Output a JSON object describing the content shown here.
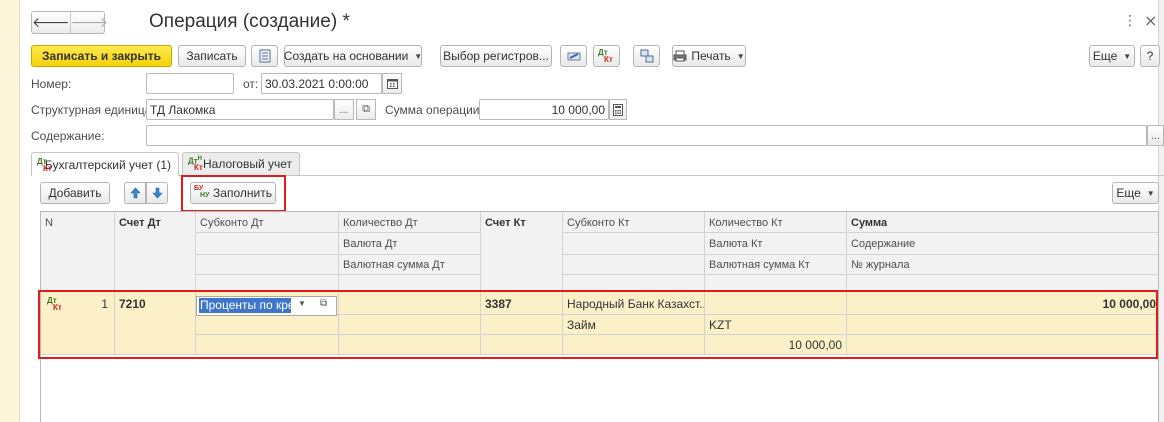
{
  "window": {
    "title": "Операция (создание) *",
    "nav": {
      "back_icon": "arrow-left-icon",
      "forward_icon": "arrow-right-icon"
    }
  },
  "toolbar": {
    "write_close": "Записать и закрыть",
    "write": "Записать",
    "create_based": "Создать на основании",
    "registers": "Выбор регистров...",
    "print": "Печать",
    "more": "Еще",
    "help": "?"
  },
  "form": {
    "number_label": "Номер:",
    "number_value": "",
    "date_label": "от:",
    "date_value": "30.03.2021  0:00:00",
    "unit_label": "Структурная единица:",
    "unit_value": "ТД Лакомка",
    "unit_select": "...",
    "amount_label": "Сумма операции:",
    "amount_value": "10 000,00",
    "content_label": "Содержание:",
    "content_value": "",
    "content_select": "..."
  },
  "tabs": [
    {
      "label": "Бухгалтерский учет (1)",
      "icon_top": "Дт",
      "icon_bottom": "Кт"
    },
    {
      "label": "Налоговый учет",
      "icon_top": "Дт",
      "icon_sup": "Н",
      "icon_bottom": "Кт"
    }
  ],
  "table_toolbar": {
    "add": "Добавить",
    "fill": "Заполнить",
    "fill_icon_text": "БУ НУ",
    "more": "Еще"
  },
  "table": {
    "headers": {
      "n": "N",
      "acc_dt": "Счет Дт",
      "subconto_dt": "Субконто Дт",
      "qty_dt": "Количество Дт",
      "cur_dt": "Валюта Дт",
      "cur_sum_dt": "Валютная сумма Дт",
      "acc_kt": "Счет Кт",
      "subconto_kt": "Субконто Кт",
      "qty_kt": "Количество Кт",
      "cur_kt": "Валюта Кт",
      "cur_sum_kt": "Валютная сумма Кт",
      "sum": "Сумма",
      "content": "Содержание",
      "journal": "№ журнала"
    },
    "rows": [
      {
        "icon_top": "Дт",
        "icon_bottom": "Кт",
        "n": "1",
        "acc_dt": "7210",
        "subconto_dt_1": "Проценты по кред",
        "acc_kt": "3387",
        "subconto_kt_1": "Народный Банк Казахст...",
        "subconto_kt_2": "Займ",
        "cur_kt": "KZT",
        "cur_sum_kt": "10 000,00",
        "sum": "10 000,00"
      }
    ]
  }
}
